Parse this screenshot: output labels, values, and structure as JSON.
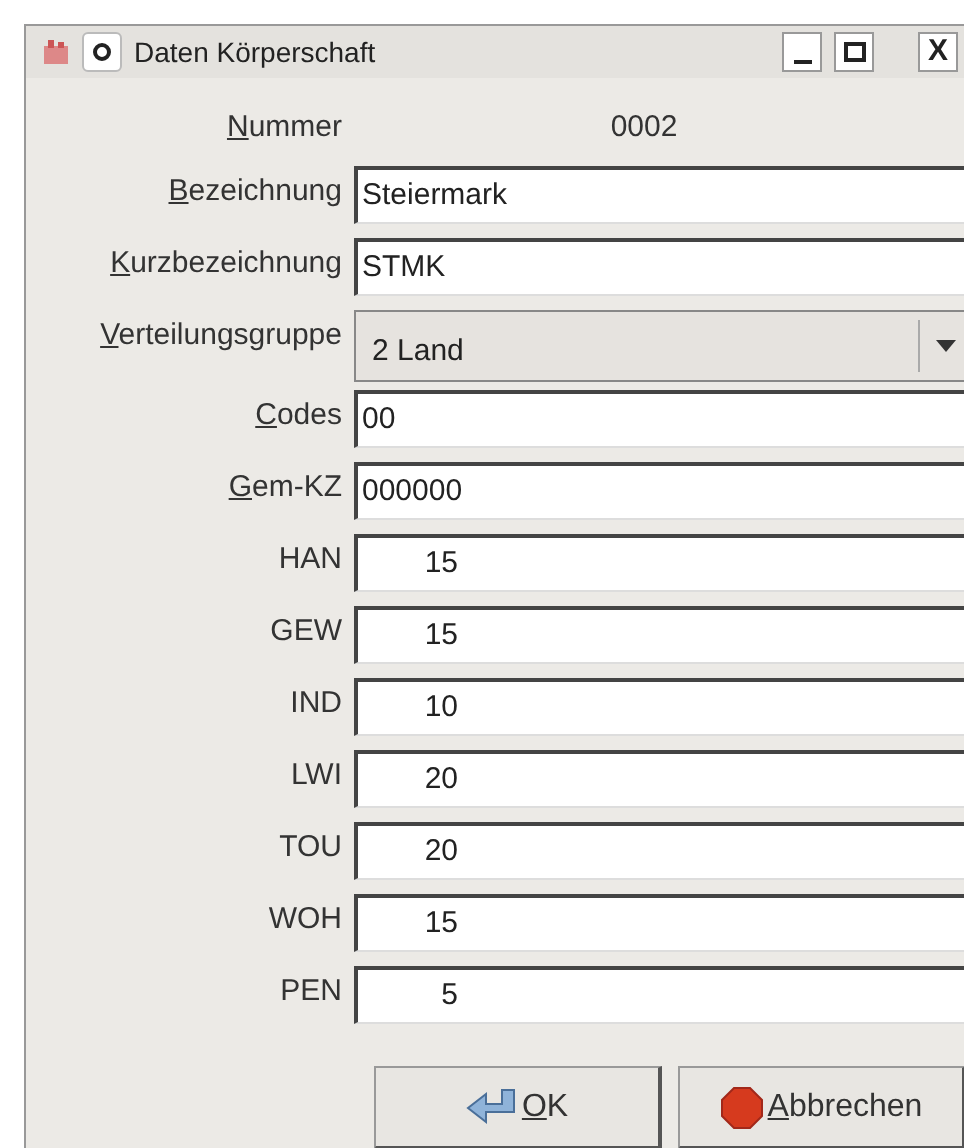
{
  "window": {
    "title": "Daten Körperschaft",
    "close_glyph": "X"
  },
  "number": {
    "label": "Nummer",
    "mnemonic": true,
    "value": "0002"
  },
  "fields": [
    {
      "label": "Bezeichnung",
      "mnemonic": true,
      "kind": "text",
      "value": "Steiermark"
    },
    {
      "label": "Kurzbezeichnung",
      "mnemonic": true,
      "kind": "text",
      "value": "STMK"
    },
    {
      "label": "Verteilungsgruppe",
      "mnemonic": true,
      "kind": "combo",
      "value": "2 Land"
    },
    {
      "label": "Codes",
      "mnemonic": true,
      "kind": "text",
      "value": "00"
    },
    {
      "label": "Gem-KZ",
      "mnemonic": true,
      "kind": "text",
      "value": "000000"
    },
    {
      "label": "HAN",
      "mnemonic": false,
      "kind": "number",
      "value": "15"
    },
    {
      "label": "GEW",
      "mnemonic": false,
      "kind": "number",
      "value": "15"
    },
    {
      "label": "IND",
      "mnemonic": false,
      "kind": "number",
      "value": "10"
    },
    {
      "label": "LWI",
      "mnemonic": false,
      "kind": "number",
      "value": "20"
    },
    {
      "label": "TOU",
      "mnemonic": false,
      "kind": "number",
      "value": "20"
    },
    {
      "label": "WOH",
      "mnemonic": false,
      "kind": "number",
      "value": "15"
    },
    {
      "label": "PEN",
      "mnemonic": false,
      "kind": "number",
      "value": "5"
    }
  ],
  "buttons": [
    {
      "label": "OK",
      "kind": "ok",
      "mnemonic": true
    },
    {
      "label": "Abbrechen",
      "kind": "cancel",
      "mnemonic": true
    }
  ]
}
